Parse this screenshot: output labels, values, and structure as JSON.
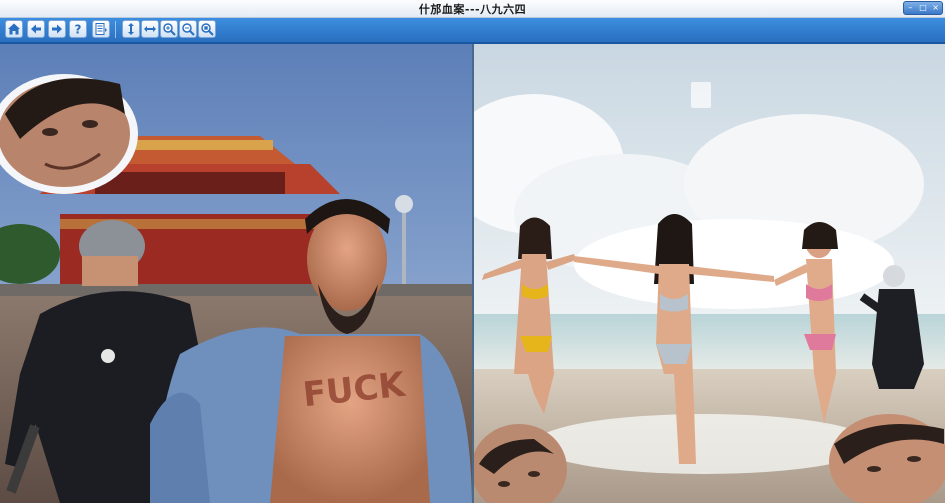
{
  "window": {
    "title": "什邡血案---八九六四"
  },
  "toolbar": {
    "buttons": [
      {
        "name": "home-icon",
        "glyph": "home"
      },
      {
        "name": "back-arrow-icon",
        "glyph": "left"
      },
      {
        "name": "forward-arrow-icon",
        "glyph": "right"
      },
      {
        "name": "help-icon",
        "glyph": "?"
      },
      {
        "name": "page-list-icon",
        "glyph": "list"
      },
      {
        "name": "fit-height-icon",
        "glyph": "vert"
      },
      {
        "name": "fit-width-icon",
        "glyph": "horiz"
      },
      {
        "name": "zoom-in-icon",
        "glyph": "zin"
      },
      {
        "name": "zoom-out-icon",
        "glyph": "zout"
      },
      {
        "name": "zoom-actual-icon",
        "glyph": "zfit"
      }
    ]
  },
  "left_image": {
    "tattoo_text": "FUCK"
  },
  "colors": {
    "toolbar": "#2f7bd0",
    "title": "#1a1a1a",
    "sky_left": "#6d8fc4",
    "sky_right": "#dfe8ef"
  }
}
